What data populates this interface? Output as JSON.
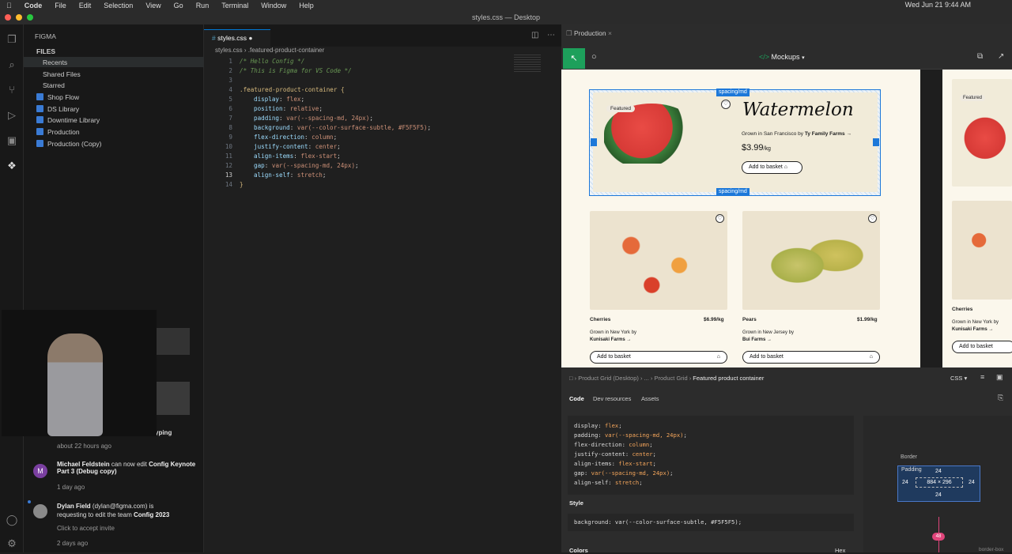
{
  "menubar": {
    "app": "Code",
    "items": [
      "File",
      "Edit",
      "Selection",
      "View",
      "Go",
      "Run",
      "Terminal",
      "Window",
      "Help"
    ],
    "clock": "Wed Jun 21  9:44 AM"
  },
  "window": {
    "title": "styles.css — Desktop"
  },
  "sidebar": {
    "title": "FIGMA",
    "section": "FILES",
    "items": [
      "Recents",
      "Shared Files",
      "Starred"
    ],
    "starred": [
      "Shop Flow",
      "DS Library",
      "Downtime Library",
      "Production",
      "Production (Copy)"
    ]
  },
  "feed": [
    {
      "text_tail": "yping",
      "time": "about 22 hours ago"
    },
    {
      "avatar": "M",
      "name": "Michael Feldstein",
      "action": "can now edit",
      "target": "Config Keynote Part 3 (Debug copy)",
      "time": "1 day ago"
    },
    {
      "name": "Dylan Field",
      "email": "(dylan@figma.com)",
      "action": "is requesting to edit the team",
      "target": "Config 2023",
      "extra": "Click to accept invite",
      "time": "2 days ago"
    }
  ],
  "editor": {
    "tab": "styles.css",
    "breadcrumb_file": "styles.css",
    "breadcrumb_selector": ".featured-product-container",
    "lines": [
      {
        "n": "1",
        "html": "cm",
        "text": "/* Hello Config */"
      },
      {
        "n": "2",
        "html": "cm",
        "text": "/* This is Figma for VS Code */"
      },
      {
        "n": "3",
        "html": "",
        "text": ""
      },
      {
        "n": "4",
        "html": "sel",
        "text": ".featured-product-container {"
      },
      {
        "n": "5",
        "prop": "display",
        "val": "flex"
      },
      {
        "n": "6",
        "prop": "position",
        "val": "relative"
      },
      {
        "n": "7",
        "prop": "padding",
        "val": "var(--spacing-md, 24px)"
      },
      {
        "n": "8",
        "prop": "background",
        "val": "var(--color-surface-subtle, #F5F5F5)"
      },
      {
        "n": "9",
        "prop": "flex-direction",
        "val": "column"
      },
      {
        "n": "10",
        "prop": "justify-content",
        "val": "center"
      },
      {
        "n": "11",
        "prop": "align-items",
        "val": "flex-start"
      },
      {
        "n": "12",
        "prop": "gap",
        "val": "var(--spacing-md, 24px)"
      },
      {
        "n": "13",
        "prop": "align-self",
        "val": "stretch"
      },
      {
        "n": "14",
        "html": "sel",
        "text": "}"
      }
    ]
  },
  "figma": {
    "tab": "Production",
    "file": "Mockups",
    "spacing_label": "spacing/md",
    "featured": {
      "badge": "Featured",
      "title": "Watermelon",
      "grown": "Grown in San Francisco by",
      "farm": "Ty Family Farms →",
      "price": "$3.99",
      "unit": "/kg",
      "button": "Add to basket"
    },
    "products": [
      {
        "name": "Cherries",
        "price": "$6.99/kg",
        "grown": "Grown in New York by",
        "farm": "Kunisaki Farms →",
        "button": "Add to basket"
      },
      {
        "name": "Pears",
        "price": "$1.99/kg",
        "grown": "Grown in New Jersey by",
        "farm": "Bui Farms →",
        "button": "Add to basket"
      }
    ],
    "side": {
      "badge": "Featured",
      "name": "Cherries",
      "grown": "Grown in New York by",
      "farm": "Kunisaki Farms →",
      "button": "Add to basket"
    }
  },
  "devpanel": {
    "crumbs": [
      "Product Grid (Desktop)",
      "...",
      "Product Grid",
      "Featured product container"
    ],
    "lang": "CSS",
    "tabs": [
      "Code",
      "Dev resources",
      "Assets"
    ],
    "code": [
      [
        "display",
        "flex"
      ],
      [
        "padding",
        "var(--spacing-md, 24px)"
      ],
      [
        "flex-direction",
        "column"
      ],
      [
        "justify-content",
        "center"
      ],
      [
        "align-items",
        "flex-start"
      ],
      [
        "gap",
        "var(--spacing-md, 24px)"
      ],
      [
        "align-self",
        "stretch"
      ]
    ],
    "style_label": "Style",
    "style_code": "background: var(--color-surface-subtle, #F5F5F5);",
    "colors_label": "Colors",
    "more_label": "Hex",
    "box": {
      "border": "Border",
      "padding": "Padding",
      "size": "884 × 296",
      "top": "24",
      "left": "24",
      "right": "24",
      "bottom": "24",
      "gap": "48",
      "boxsizing": "border-box"
    }
  }
}
